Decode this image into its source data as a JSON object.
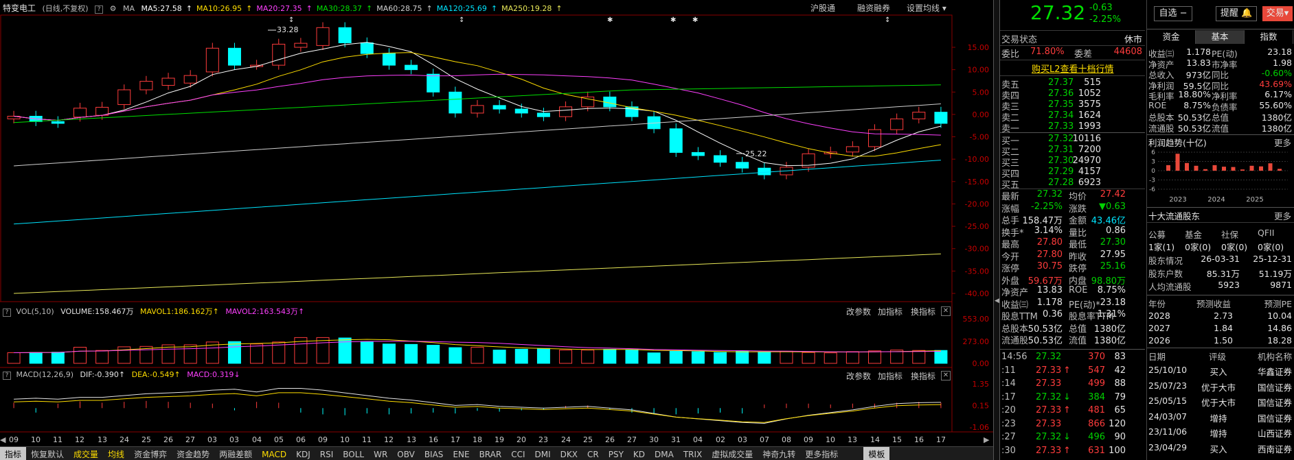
{
  "header": {
    "stock_name": "特变电工",
    "period": "(日线,不复权)",
    "ma_label": "MA",
    "ma": [
      {
        "label": "MA5:27.58",
        "color": "#ffffff"
      },
      {
        "label": "MA10:26.95",
        "color": "#ffde00"
      },
      {
        "label": "MA20:27.35",
        "color": "#ff40ff"
      },
      {
        "label": "MA30:28.37",
        "color": "#00e000"
      },
      {
        "label": "MA60:28.75",
        "color": "#d0d0d0"
      },
      {
        "label": "MA120:25.69",
        "color": "#00e5ff"
      },
      {
        "label": "MA250:19.28",
        "color": "#e8e858"
      }
    ],
    "links": [
      "沪股通",
      "融资融券",
      "设置均线"
    ]
  },
  "price_axis": [
    "15.00",
    "10.00",
    "5.00",
    "0.00",
    "-5.00",
    "-10.00",
    "-15.00",
    "-20.00",
    "-25.00",
    "-30.00",
    "-35.00",
    "-40.00"
  ],
  "annotations": {
    "high": "33.28",
    "low": "25.22"
  },
  "volume": {
    "title": "VOL(5,10)",
    "v1": "VOLUME:158.467万",
    "v2": "MAVOL1:186.162万",
    "v3": "MAVOL2:163.543万",
    "axis": [
      "553.00",
      "273.00",
      "0.00"
    ],
    "links": [
      "改参数",
      "加指标",
      "换指标"
    ]
  },
  "macd": {
    "title": "MACD(12,26,9)",
    "dif": "DIF:-0.390",
    "dea": "DEA:-0.549",
    "macd": "MACD:0.319",
    "axis": [
      "1.35",
      "0.15",
      "-1.06"
    ],
    "links": [
      "改参数",
      "加指标",
      "换指标"
    ]
  },
  "xaxis": [
    "09",
    "10",
    "11",
    "12",
    "13",
    "24",
    "25",
    "26",
    "27",
    "03",
    "03",
    "04",
    "05",
    "06",
    "09",
    "10",
    "11",
    "12",
    "13",
    "16",
    "17",
    "18",
    "19",
    "20",
    "23",
    "24",
    "25",
    "26",
    "27",
    "30",
    "31",
    "04",
    "02",
    "03",
    "07",
    "08",
    "09",
    "10",
    "13",
    "14",
    "15",
    "16",
    "17"
  ],
  "tabs": [
    "指标",
    "恢复默认",
    "成交量",
    "均线",
    "资金博弈",
    "资金趋势",
    "两融差额",
    "MACD",
    "KDJ",
    "RSI",
    "BOLL",
    "WR",
    "OBV",
    "BIAS",
    "ENE",
    "BRAR",
    "CCI",
    "DMI",
    "DKX",
    "CR",
    "PSY",
    "KD",
    "DMA",
    "TRIX",
    "虚拟成交量",
    "神奇九转",
    "更多指标",
    "模板"
  ],
  "quote": {
    "price": "27.32",
    "change": "-0.63",
    "pct": "-2.25%"
  },
  "buttons": {
    "watch": "自选",
    "alert": "提醒",
    "trade": "交易"
  },
  "trade_status": {
    "label": "交易状态",
    "value": "休市"
  },
  "ratio": {
    "label1": "委比",
    "v1": "71.80%",
    "label2": "委差",
    "v2": "44608"
  },
  "l2_link": "购买L2查看十档行情",
  "sells": [
    {
      "l": "卖五",
      "p": "27.37",
      "v": "515"
    },
    {
      "l": "卖四",
      "p": "27.36",
      "v": "1052"
    },
    {
      "l": "卖三",
      "p": "27.35",
      "v": "3575"
    },
    {
      "l": "卖二",
      "p": "27.34",
      "v": "1624"
    },
    {
      "l": "卖一",
      "p": "27.33",
      "v": "1993"
    }
  ],
  "buys": [
    {
      "l": "买一",
      "p": "27.32",
      "v": "10116"
    },
    {
      "l": "买二",
      "p": "27.31",
      "v": "7200"
    },
    {
      "l": "买三",
      "p": "27.30",
      "v": "24970"
    },
    {
      "l": "买四",
      "p": "27.29",
      "v": "4157"
    },
    {
      "l": "买五",
      "p": "27.28",
      "v": "6923"
    }
  ],
  "stats": [
    {
      "a": "最新",
      "av": "27.32",
      "ac": "grn",
      "b": "均价",
      "bv": "27.42",
      "bc": "red"
    },
    {
      "a": "涨幅",
      "av": "-2.25%",
      "ac": "grn",
      "b": "涨跌",
      "bv": "▼0.63",
      "bc": "grn"
    },
    {
      "a": "总手",
      "av": "158.47万",
      "ac": "wht",
      "b": "金额",
      "bv": "43.46亿",
      "bc": "cyan"
    },
    {
      "a": "换手*",
      "av": "3.14%",
      "ac": "wht",
      "b": "量比",
      "bv": "0.86",
      "bc": "wht"
    },
    {
      "a": "最高",
      "av": "27.80",
      "ac": "red",
      "b": "最低",
      "bv": "27.30",
      "bc": "grn"
    },
    {
      "a": "今开",
      "av": "27.80",
      "ac": "red",
      "b": "昨收",
      "bv": "27.95",
      "bc": "wht"
    },
    {
      "a": "涨停",
      "av": "30.75",
      "ac": "red",
      "b": "跌停",
      "bv": "25.16",
      "bc": "grn"
    },
    {
      "a": "外盘",
      "av": "59.67万",
      "ac": "red",
      "b": "内盘",
      "bv": "98.80万",
      "bc": "grn"
    },
    {
      "a": "净资产",
      "av": "13.83",
      "ac": "wht",
      "b": "ROE",
      "bv": "8.75%",
      "bc": "wht"
    },
    {
      "a": "收益㈢",
      "av": "1.178",
      "ac": "wht",
      "b": "PE(动)*",
      "bv": "23.18",
      "bc": "wht"
    },
    {
      "a": "股息TTM",
      "av": "0.36",
      "ac": "wht",
      "b": "股息率TTM",
      "bv": "1.31%",
      "bc": "wht"
    },
    {
      "a": "总股本",
      "av": "50.53亿",
      "ac": "wht",
      "b": "总值",
      "bv": "1380亿",
      "bc": "wht"
    },
    {
      "a": "流通股",
      "av": "50.53亿",
      "ac": "wht",
      "b": "流值",
      "bv": "1380亿",
      "bc": "wht"
    }
  ],
  "ticks": [
    {
      "t": "14:56",
      "p": "27.32",
      "a": "",
      "v": "370",
      "n": "83",
      "pc": "grn",
      "vc": "red"
    },
    {
      "t": ":11",
      "p": "27.33",
      "a": "↑",
      "v": "547",
      "n": "42",
      "pc": "red",
      "vc": "red"
    },
    {
      "t": ":14",
      "p": "27.33",
      "a": "",
      "v": "499",
      "n": "88",
      "pc": "red",
      "vc": "red"
    },
    {
      "t": ":17",
      "p": "27.32",
      "a": "↓",
      "v": "384",
      "n": "79",
      "pc": "grn",
      "vc": "grn"
    },
    {
      "t": ":20",
      "p": "27.33",
      "a": "↑",
      "v": "481",
      "n": "65",
      "pc": "red",
      "vc": "red"
    },
    {
      "t": ":23",
      "p": "27.33",
      "a": "",
      "v": "866",
      "n": "120",
      "pc": "red",
      "vc": "red"
    },
    {
      "t": ":27",
      "p": "27.32",
      "a": "↓",
      "v": "496",
      "n": "90",
      "pc": "grn",
      "vc": "grn"
    },
    {
      "t": ":30",
      "p": "27.33",
      "a": "↑",
      "v": "631",
      "n": "100",
      "pc": "red",
      "vc": "red"
    }
  ],
  "right_tabs": [
    "资金",
    "基本",
    "指数"
  ],
  "fund": [
    {
      "a": "收益㈢",
      "av": "1.178",
      "b": "PE(动)",
      "bv": "23.18",
      "bc": "wht"
    },
    {
      "a": "净资产",
      "av": "13.83",
      "b": "市净率",
      "bv": "1.98",
      "bc": "wht"
    },
    {
      "a": "总收入",
      "av": "973亿",
      "b": "同比",
      "bv": "-0.60%",
      "bc": "grn"
    },
    {
      "a": "净利润",
      "av": "59.5亿",
      "b": "同比",
      "bv": "43.69%",
      "bc": "red"
    },
    {
      "a": "毛利率",
      "av": "18.80%",
      "b": "净利率",
      "bv": "6.17%",
      "bc": "wht"
    },
    {
      "a": "ROE",
      "av": "8.75%",
      "b": "负债率",
      "bv": "55.60%",
      "bc": "wht"
    },
    {
      "a": "总股本",
      "av": "50.53亿",
      "b": "总值",
      "bv": "1380亿",
      "bc": "wht"
    },
    {
      "a": "流通股",
      "av": "50.53亿",
      "b": "流值",
      "bv": "1380亿",
      "bc": "wht"
    }
  ],
  "profit": {
    "title": "利润趋势(十亿)",
    "more": "更多",
    "yaxis": [
      "6",
      "3",
      "0",
      "-3",
      "-6"
    ],
    "years": [
      "2023",
      "2024",
      "2025"
    ],
    "bars": [
      1.8,
      5.5,
      2.5,
      1.6,
      0.5,
      1.8,
      1.3,
      1.2,
      0.4,
      1.6,
      1.4,
      2.4,
      0.6
    ]
  },
  "holders": {
    "title": "十大流通股东",
    "more": "更多",
    "cols": [
      "公募",
      "基金",
      "社保",
      "QFII"
    ],
    "vals": [
      "1家(1)",
      "0家(0)",
      "0家(0)",
      "0家(0)"
    ],
    "info": [
      {
        "l": "股东情况",
        "a": "26-03-31",
        "b": "25-12-31"
      },
      {
        "l": "股东户数",
        "a": "85.31万",
        "b": "51.19万"
      },
      {
        "l": "人均流通股",
        "a": "5923",
        "b": "9871"
      }
    ]
  },
  "forecast": {
    "cols": [
      "年份",
      "预测收益",
      "预测PE"
    ],
    "rows": [
      [
        "2028",
        "2.73",
        "10.04"
      ],
      [
        "2027",
        "1.84",
        "14.86"
      ],
      [
        "2026",
        "1.50",
        "18.28"
      ]
    ]
  },
  "ratings": {
    "cols": [
      "日期",
      "评级",
      "机构名称"
    ],
    "rows": [
      [
        "25/10/10",
        "买入",
        "华鑫证券"
      ],
      [
        "25/07/23",
        "优于大市",
        "国信证券"
      ],
      [
        "25/05/15",
        "优于大市",
        "国信证券"
      ],
      [
        "24/03/07",
        "增持",
        "国信证券"
      ],
      [
        "23/11/06",
        "增持",
        "山西证券"
      ],
      [
        "23/04/29",
        "买入",
        "西南证券"
      ]
    ]
  },
  "colors": {
    "up": "#ff3c3c",
    "down": "#00ffff",
    "ma5": "#ffffff",
    "ma10": "#ffde00",
    "ma20": "#ff40ff",
    "ma30": "#00e000",
    "ma60": "#d0d0d0",
    "ma120": "#00e5ff",
    "ma250": "#e8e858"
  }
}
